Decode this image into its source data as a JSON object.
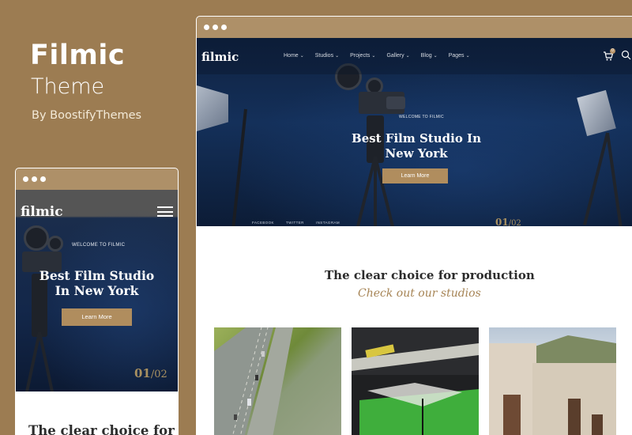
{
  "promo": {
    "title": "Filmic",
    "subtitle": "Theme",
    "byline": "By BoostifyThemes"
  },
  "colors": {
    "background": "#9c7c52",
    "window_bar": "#ae9068",
    "accent": "#b08d5e",
    "hero": "#14305a"
  },
  "desktop": {
    "logo": "filmic",
    "nav": [
      {
        "label": "Home"
      },
      {
        "label": "Studios"
      },
      {
        "label": "Projects"
      },
      {
        "label": "Gallery"
      },
      {
        "label": "Blog"
      },
      {
        "label": "Pages"
      }
    ],
    "cart_count": "0",
    "hero": {
      "eyebrow": "WELCOME TO FILMIC",
      "heading_line1": "Best Film Studio In",
      "heading_line2": "New York",
      "button": "Learn More",
      "slide_current": "01",
      "slide_total": "/02",
      "social": [
        "FACEBOOK",
        "TWITTER",
        "INSTAGRAM"
      ]
    },
    "section": {
      "title": "The clear choice for production",
      "subtitle": "Check out our studios"
    },
    "studios": [
      {
        "image": "highway-aerial"
      },
      {
        "image": "green-screen-stage"
      },
      {
        "image": "studio-buildings"
      }
    ]
  },
  "mobile": {
    "logo": "filmic",
    "hero": {
      "eyebrow": "WELCOME TO FILMIC",
      "heading_line1": "Best Film Studio",
      "heading_line2": "In New York",
      "button": "Learn More",
      "slide_current": "01",
      "slide_total": "/02"
    },
    "section": {
      "title_partial": "The clear choice for"
    }
  }
}
